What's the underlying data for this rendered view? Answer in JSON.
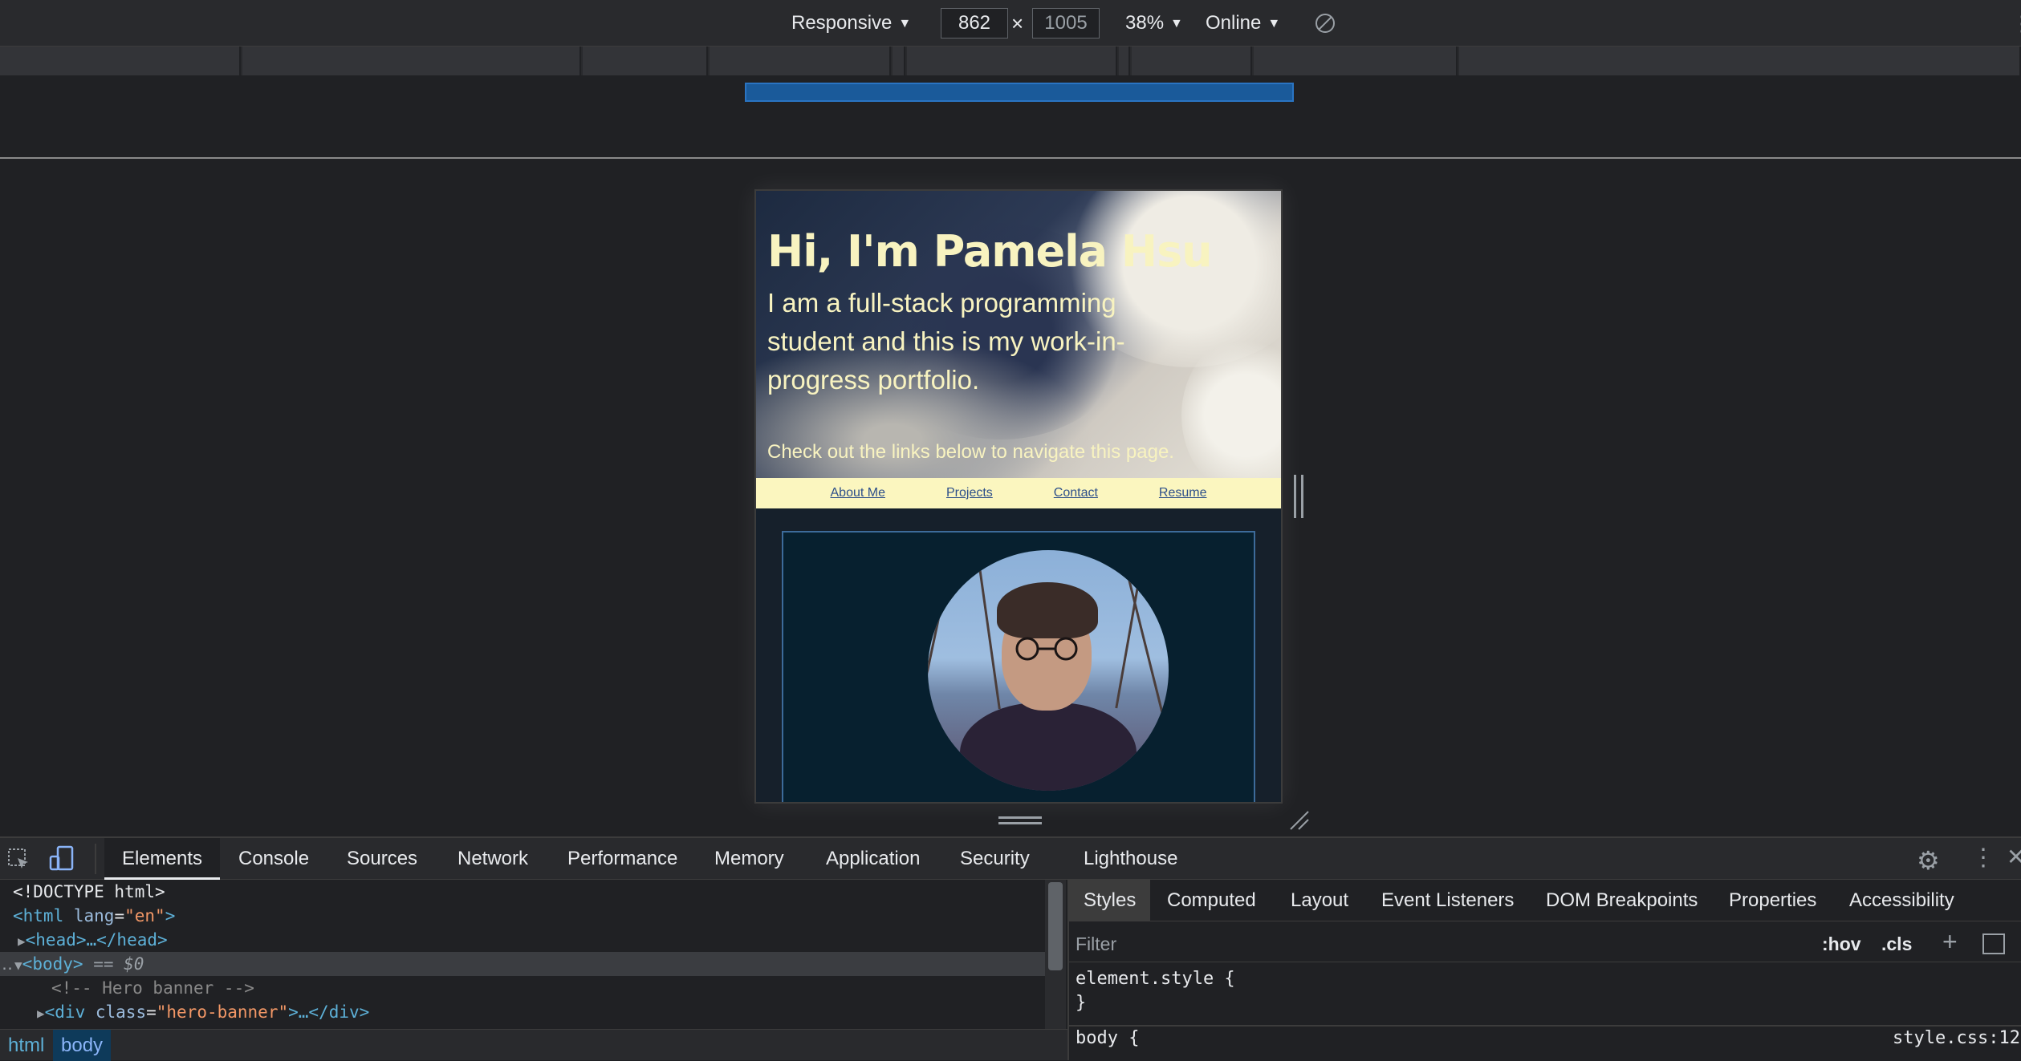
{
  "device_toolbar": {
    "device": "Responsive",
    "width": "862",
    "height": "1005",
    "times": "×",
    "zoom": "38%",
    "throttling": "Online"
  },
  "page": {
    "hero_title": "Hi, I'm Pamela Hsu",
    "hero_intro": "I am a full-stack programming student and this is my work-in-progress portfolio.",
    "hero_cta": "Check out the links below to navigate this page.",
    "nav": [
      "About Me",
      "Projects",
      "Contact",
      "Resume"
    ]
  },
  "devtools": {
    "tabs": [
      "Elements",
      "Console",
      "Sources",
      "Network",
      "Performance",
      "Memory",
      "Application",
      "Security",
      "Lighthouse"
    ],
    "active_tab": "Elements",
    "tree": {
      "doctype": "<!DOCTYPE html>",
      "html_open": "<html",
      "html_attr": "lang",
      "html_val": "\"en\"",
      "html_close": ">",
      "head": "<head>…</head>",
      "body": "<body>",
      "body_suffix": "== $0",
      "comment": "<!-- Hero banner -->",
      "div_open": "<div",
      "div_attr": "class",
      "div_val": "\"hero-banner\"",
      "div_close": ">…</div>"
    },
    "breadcrumbs": [
      "html",
      "body"
    ],
    "styles_tabs": [
      "Styles",
      "Computed",
      "Layout",
      "Event Listeners",
      "DOM Breakpoints",
      "Properties",
      "Accessibility"
    ],
    "filter_placeholder": "Filter",
    "hov": ":hov",
    "cls": ".cls",
    "element_style_open": "element.style {",
    "element_style_close": "}",
    "body_rule": "body {",
    "source_link": "style.css:12"
  },
  "colors": {
    "accent_blue": "#1a5a9a",
    "hero_text": "#f8f3c0",
    "nav_bg": "#fbf6bf"
  }
}
